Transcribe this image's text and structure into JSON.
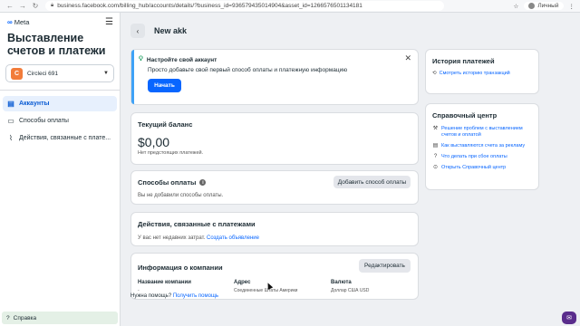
{
  "browser": {
    "url": "business.facebook.com/billing_hub/accounts/details/?business_id=936579435014904&asset_id=1266576501134181",
    "profile_label": "Личный"
  },
  "sidebar": {
    "logo": "Meta",
    "title": "Выставление счетов и платежи",
    "account": {
      "initial": "C",
      "name": "Circleci 691"
    },
    "items": [
      {
        "label": "Аккаунты",
        "icon": "accounts-icon",
        "active": true
      },
      {
        "label": "Способы оплаты",
        "icon": "card-icon",
        "active": false
      },
      {
        "label": "Действия, связанные с плате...",
        "icon": "activity-icon",
        "active": false
      }
    ],
    "help_label": "Справка"
  },
  "header": {
    "title": "New akk"
  },
  "setup": {
    "title": "Настройте свой аккаунт",
    "description": "Просто добавьте свой первый способ оплаты и платежную информацию",
    "button": "Начать"
  },
  "balance": {
    "title": "Текущий баланс",
    "amount": "$0,00",
    "note": "Нет предстоящих платежей."
  },
  "payment_methods": {
    "title": "Способы оплаты",
    "empty": "Вы не добавили способы оплаты.",
    "button": "Добавить способ оплаты"
  },
  "activity": {
    "title": "Действия, связанные с платежами",
    "text": "У вас нет недавних затрат.",
    "link": "Создать объявление"
  },
  "company": {
    "title": "Информация о компании",
    "button": "Редактировать",
    "fields": [
      {
        "label": "Название компании",
        "value": "-"
      },
      {
        "label": "Адрес",
        "value": "Соединенные Штаты Америки"
      },
      {
        "label": "Валюта",
        "value": "Доллар США USD"
      }
    ]
  },
  "need_help": {
    "text": "Нужна помощь?",
    "link": "Получить помощь"
  },
  "history": {
    "title": "История платежей",
    "link": "Смотреть историю транзакций"
  },
  "help_center": {
    "title": "Справочный центр",
    "links": [
      "Решение проблем с выставлением счетов и оплатой",
      "Как выставляются счета за рекламу",
      "Что делать при сбое оплаты",
      "Открыть Справочный центр"
    ]
  },
  "colors": {
    "accent": "#0866ff",
    "active_bg": "#e7f0fd",
    "avatar": "#f27c3a",
    "help_bg": "#e4f0e6"
  }
}
